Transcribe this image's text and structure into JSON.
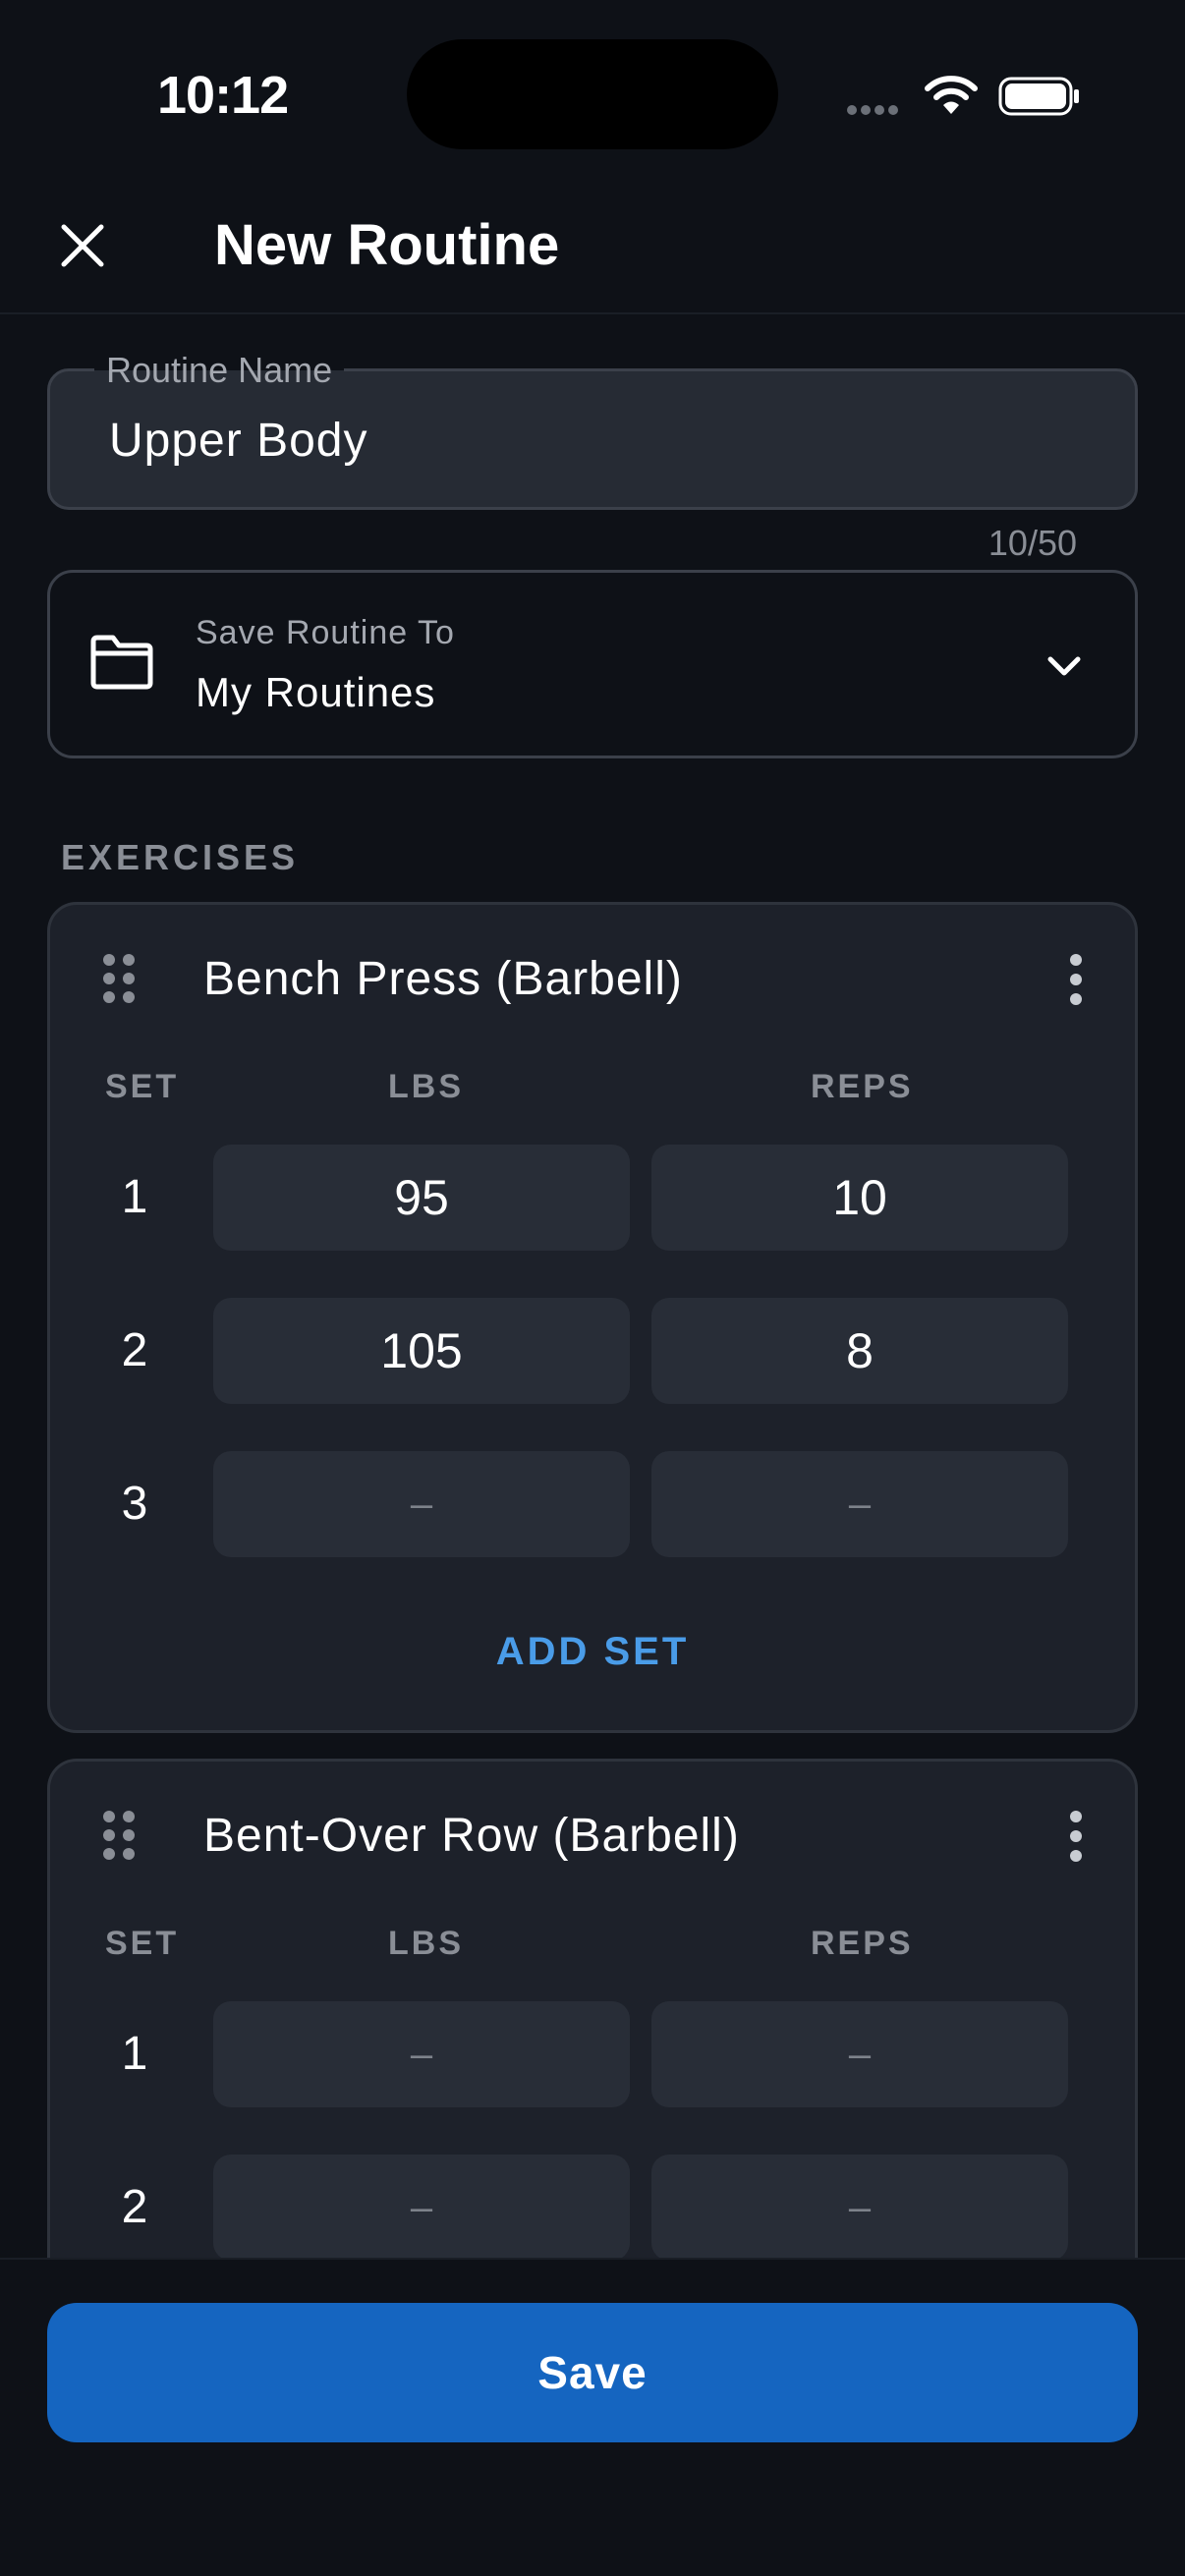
{
  "status_bar": {
    "time": "10:12"
  },
  "header": {
    "title": "New Routine"
  },
  "routine_name": {
    "label": "Routine Name",
    "value": "Upper Body",
    "char_count": "10/50"
  },
  "save_to": {
    "label": "Save Routine To",
    "value": "My Routines"
  },
  "exercises_section": {
    "title": "EXERCISES"
  },
  "columns": {
    "set": "SET",
    "lbs": "LBS",
    "reps": "REPS"
  },
  "exercises": [
    {
      "name": "Bench Press (Barbell)",
      "sets": [
        {
          "set": "1",
          "lbs": "95",
          "reps": "10"
        },
        {
          "set": "2",
          "lbs": "105",
          "reps": "8"
        },
        {
          "set": "3",
          "lbs": "–",
          "reps": "–"
        }
      ],
      "add_set_label": "ADD SET"
    },
    {
      "name": "Bent-Over Row (Barbell)",
      "sets": [
        {
          "set": "1",
          "lbs": "–",
          "reps": "–"
        },
        {
          "set": "2",
          "lbs": "–",
          "reps": "–"
        }
      ]
    }
  ],
  "footer": {
    "save_label": "Save"
  },
  "colors": {
    "background": "#0e1117",
    "card": "#1d212a",
    "accent": "#1565c0",
    "link": "#4a9ce8"
  }
}
